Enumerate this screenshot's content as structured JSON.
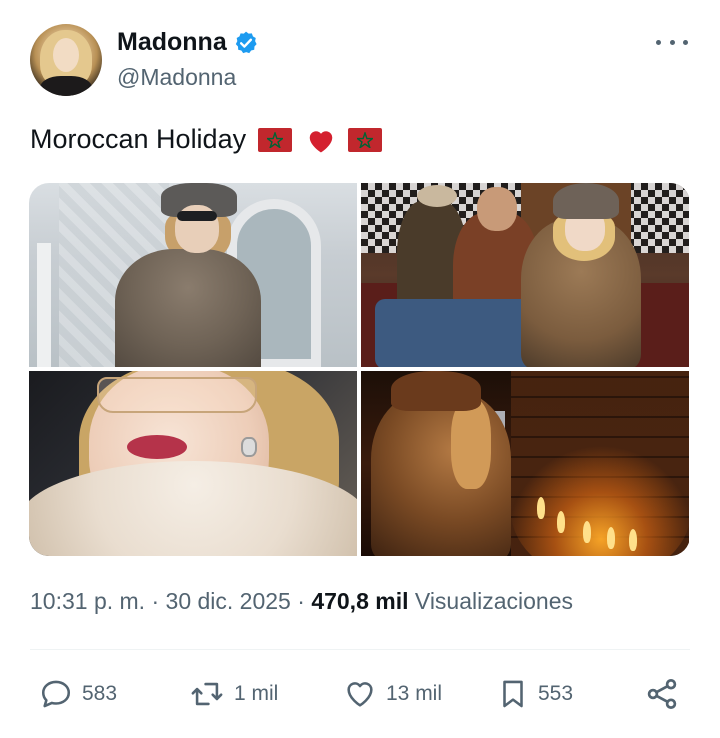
{
  "author": {
    "display_name": "Madonna",
    "handle": "@Madonna",
    "verified_color": "#1d9bf0"
  },
  "tweet": {
    "text": "Moroccan Holiday",
    "emojis": [
      "flag-morocco",
      "red-heart",
      "flag-morocco"
    ],
    "flag_color": "#c1272d",
    "star_color": "#006233",
    "heart_color": "#d4202f"
  },
  "media": {
    "photos": [
      {
        "name": "photo-woman-fur-coat-palace"
      },
      {
        "name": "photo-group-seated-drinks"
      },
      {
        "name": "photo-closeup-fur-collar"
      },
      {
        "name": "photo-candles-fireplace"
      }
    ]
  },
  "meta": {
    "time": "10:31 p. m.",
    "separator": " · ",
    "date": "30 dic. 2025",
    "views_count": "470,8 mil",
    "views_label": "Visualizaciones"
  },
  "actions": {
    "replies": "583",
    "reposts": "1 mil",
    "likes": "13 mil",
    "bookmarks": "553",
    "icon_color": "#536471"
  },
  "icons": {
    "more": "more-icon",
    "verified": "verified-badge-icon",
    "reply": "reply-icon",
    "repost": "repost-icon",
    "like": "like-icon",
    "bookmark": "bookmark-icon",
    "share": "share-icon"
  }
}
